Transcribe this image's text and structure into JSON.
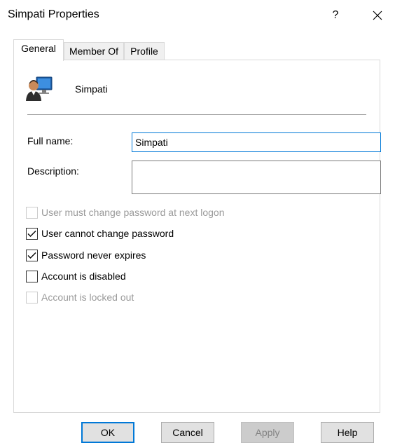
{
  "window": {
    "title": "Simpati Properties",
    "help_label": "?",
    "close_icon": "close-icon"
  },
  "tabs": [
    {
      "label": "General",
      "active": true
    },
    {
      "label": "Member Of",
      "active": false
    },
    {
      "label": "Profile",
      "active": false
    }
  ],
  "general": {
    "user_icon": "user-icon",
    "user_name": "Simpati",
    "full_name_label": "Full name:",
    "full_name_value": "Simpati",
    "description_label": "Description:",
    "description_value": ""
  },
  "options": [
    {
      "label": "User must change password at next logon",
      "checked": false,
      "enabled": false
    },
    {
      "label": "User cannot change password",
      "checked": true,
      "enabled": true
    },
    {
      "label": "Password never expires",
      "checked": true,
      "enabled": true
    },
    {
      "label": "Account is disabled",
      "checked": false,
      "enabled": true
    },
    {
      "label": "Account is locked out",
      "checked": false,
      "enabled": false
    }
  ],
  "buttons": {
    "ok": "OK",
    "cancel": "Cancel",
    "apply": "Apply",
    "help": "Help"
  },
  "colors": {
    "accent": "#0078d7",
    "disabled_text": "#9a9a9a"
  }
}
